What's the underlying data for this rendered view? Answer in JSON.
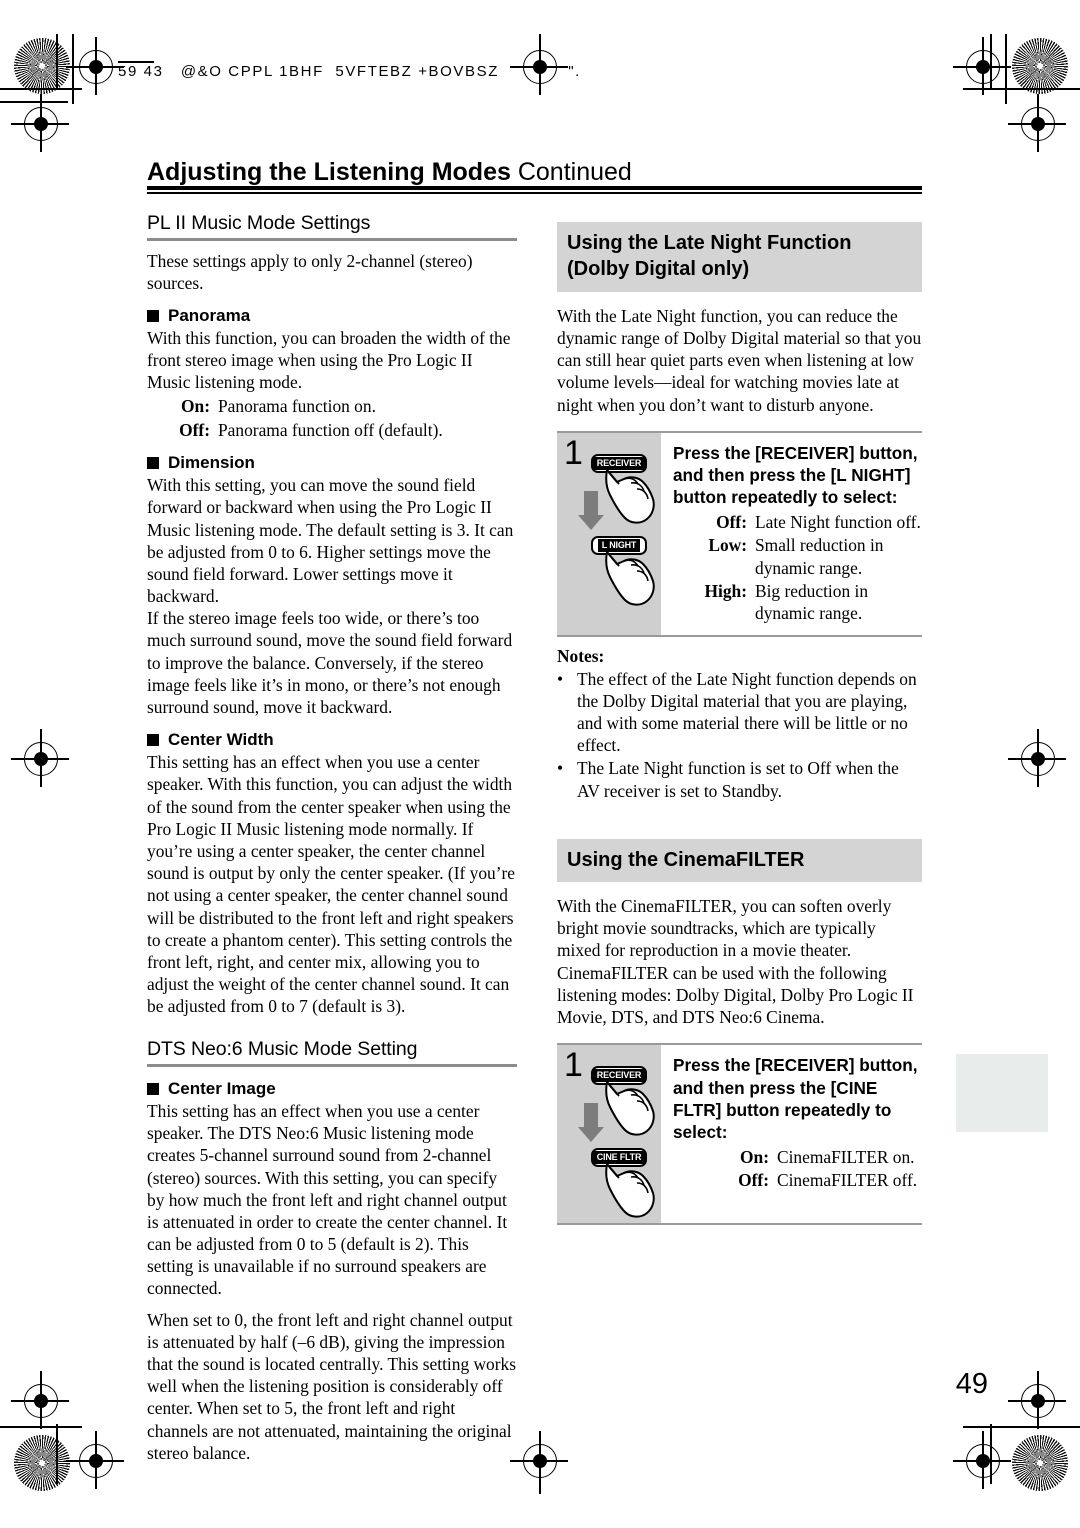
{
  "document": {
    "running_head": "59 43   @&O CPPL 1BHF  5VFTEBZ +BOVBSZ            \".",
    "chapter_title_bold": "Adjusting the Listening Modes",
    "chapter_title_regular": "Continued",
    "page_number": "49"
  },
  "left_column": {
    "section1": {
      "heading": "PL II Music Mode Settings",
      "intro": "These settings apply to only 2-channel (stereo) sources.",
      "panorama": {
        "title": "Panorama",
        "body": "With this function, you can broaden the width of the front stereo image when using the Pro Logic II Music listening mode.",
        "options": [
          {
            "label": "On:",
            "text": "Panorama function on."
          },
          {
            "label": "Off:",
            "text": "Panorama function off (default)."
          }
        ]
      },
      "dimension": {
        "title": "Dimension",
        "para1": "With this setting, you can move the sound field forward or backward when using the Pro Logic II Music listening mode. The default setting is 3. It can be adjusted from 0 to 6. Higher settings move the sound field forward. Lower settings move it backward.",
        "para2": "If the stereo image feels too wide, or there’s too much surround sound, move the sound field forward to improve the balance. Conversely, if the stereo image feels like it’s in mono, or there’s not enough surround sound, move it backward."
      },
      "center_width": {
        "title": "Center Width",
        "body": "This setting has an effect when you use a center speaker. With this function, you can adjust the width of the sound from the center speaker when using the Pro Logic II Music listening mode normally. If you’re using a center speaker, the center channel sound is output by only the center speaker. (If you’re not using a center speaker, the center channel sound will be distributed to the front left and right speakers to create a phantom center). This setting controls the front left, right, and center mix, allowing you to adjust the weight of the center channel sound. It can be adjusted from 0 to 7 (default is 3)."
      }
    },
    "section2": {
      "heading": "DTS Neo:6 Music Mode Setting",
      "center_image": {
        "title": "Center Image",
        "para1": "This setting has an effect when you use a center speaker. The DTS Neo:6 Music listening mode creates 5-channel surround sound from 2-channel (stereo) sources. With this setting, you can specify by how much the front left and right channel output is attenuated in order to create the center channel. It can be adjusted from 0 to 5 (default is 2). This setting is unavailable if no surround speakers are connected.",
        "para2": "When set to 0, the front left and right channel output is attenuated by half (–6 dB), giving the impression that the sound is located centrally. This setting works well when the listening position is considerably off center. When set to 5, the front left and right channels are not attenuated, maintaining the original stereo balance."
      }
    }
  },
  "right_column": {
    "late_night": {
      "banner_line1": "Using the Late Night Function",
      "banner_line2": "(Dolby Digital only)",
      "body": "With the Late Night function, you can reduce the dynamic range of Dolby Digital material so that you can still hear quiet parts even when listening at low volume levels—ideal for watching movies late at night when you don’t want to disturb anyone.",
      "step": {
        "number": "1",
        "button_top": "RECEIVER",
        "button_bottom": "L NIGHT",
        "heading": "Press the [RECEIVER] button, and then press the [L NIGHT] button repeatedly to select:",
        "options": [
          {
            "label": "Off:",
            "text": "Late Night function off."
          },
          {
            "label": "Low:",
            "text": "Small reduction in dynamic range."
          },
          {
            "label": "High:",
            "text": "Big reduction in dynamic range."
          }
        ]
      },
      "notes_title": "Notes:",
      "notes": [
        "The effect of the Late Night function depends on the Dolby Digital material that you are playing, and with some material there will be little or no effect.",
        "The Late Night function is set to Off when the AV receiver is set to Standby."
      ]
    },
    "cinema_filter": {
      "banner_line1": "Using the CinemaFILTER",
      "para1": "With the CinemaFILTER, you can soften overly bright movie soundtracks, which are typically mixed for reproduction in a movie theater.",
      "para2": "CinemaFILTER can be used with the following listening modes: Dolby Digital, Dolby Pro Logic II Movie, DTS, and DTS Neo:6 Cinema.",
      "step": {
        "number": "1",
        "button_top": "RECEIVER",
        "button_bottom": "CINE FLTR",
        "heading": "Press the [RECEIVER] button, and then press the [CINE FLTR] button repeatedly to select:",
        "options": [
          {
            "label": "On:",
            "text": "CinemaFILTER on."
          },
          {
            "label": "Off:",
            "text": "CinemaFILTER off."
          }
        ]
      }
    }
  },
  "colors": {
    "banner_bg": "#d4d4d4",
    "step_illus_bg": "#cfcfcf",
    "rule_gray": "#8c8c8c",
    "thumb_tab": "#e8eceb",
    "arrow_gray": "#7d7d7d"
  }
}
